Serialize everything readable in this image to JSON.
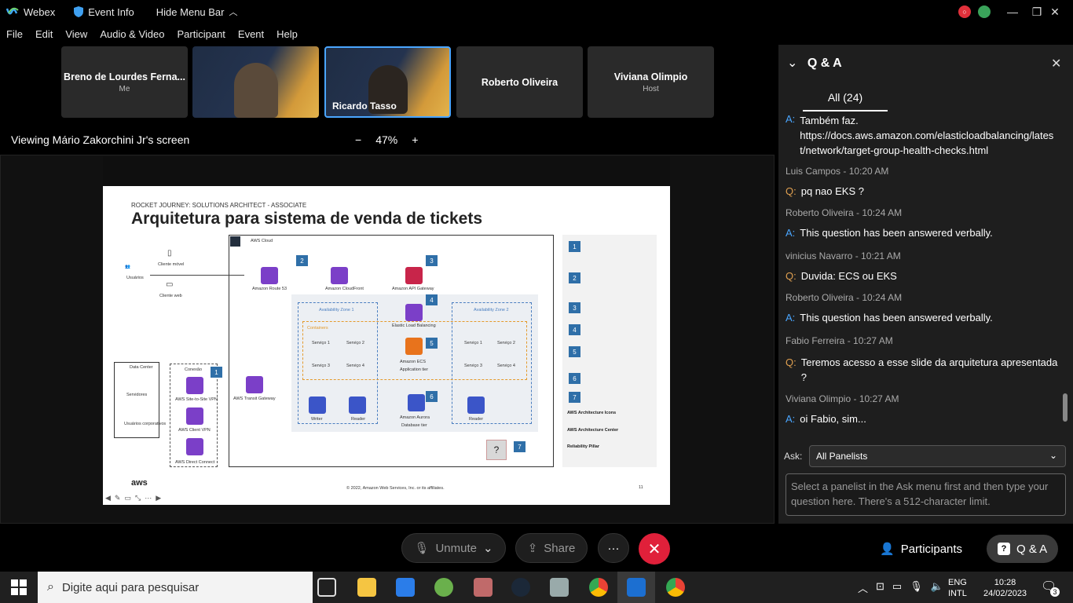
{
  "titlebar": {
    "app": "Webex",
    "event_info": "Event Info",
    "hide_menu": "Hide Menu Bar"
  },
  "menu": [
    "File",
    "Edit",
    "View",
    "Audio & Video",
    "Participant",
    "Event",
    "Help"
  ],
  "tiles": [
    {
      "name": "Breno de Lourdes Ferna...",
      "sub": "Me"
    },
    {
      "name": "",
      "sub": ""
    },
    {
      "name": "Ricardo Tasso",
      "sub": ""
    },
    {
      "name": "Roberto Oliveira",
      "sub": ""
    },
    {
      "name": "Viviana Olimpio",
      "sub": "Host"
    }
  ],
  "viewing": "Viewing Mário Zakorchini Jr's screen",
  "zoom": "47%",
  "slide": {
    "subtitle": "ROCKET JOURNEY: SOLUTIONS ARCHITECT - ASSOCIATE",
    "title": "Arquitetura para sistema de venda de tickets",
    "cloud": "AWS Cloud",
    "usuarios": "Usuários",
    "cliente_movel": "Cliente móvel",
    "cliente_web": "Cliente web",
    "route53": "Amazon Route 53",
    "cloudfront": "Amazon CloudFront",
    "apigw": "Amazon API Gateway",
    "elb": "Elastic Load Balancing",
    "ecs": "Amazon ECS",
    "app_tier": "Application tier",
    "az1": "Availability Zone 1",
    "az2": "Availability Zone 2",
    "containers": "Containers",
    "s1": "Serviço 1",
    "s2": "Serviço 2",
    "s3": "Serviço 3",
    "s4": "Serviço 4",
    "writer": "Writer",
    "reader": "Reader",
    "aurora": "Amazon Aurora",
    "db_tier": "Database tier",
    "datacenter": "Data Center",
    "servidores": "Servidores",
    "usuarios_corp": "Usuários corporativos",
    "conexao": "Conexão",
    "s2s_vpn": "AWS Site-to-Site VPN",
    "client_vpn": "AWS Client VPN",
    "direct_connect": "AWS Direct Connect",
    "transit_gw": "AWS Transit Gateway",
    "copyright": "© 2022, Amazon Web Services, Inc. or its affiliates.",
    "page": "11",
    "aws_logo": "aws",
    "notes_heads": [
      "AWS Architecture Icons",
      "AWS Architecture Center",
      "Reliability Pillar"
    ],
    "numbers": [
      "1",
      "2",
      "3",
      "4",
      "5",
      "6",
      "7"
    ]
  },
  "qa": {
    "title": "Q & A",
    "tab": "All (24)",
    "items": [
      {
        "type": "A",
        "text": "Também faz.\nhttps://docs.aws.amazon.com/elasticloadbalancing/latest/network/target-group-health-checks.html",
        "meta": ""
      },
      {
        "type": "Q",
        "meta": "Luis Campos - 10:20 AM",
        "text": "pq nao EKS ?"
      },
      {
        "type": "A",
        "meta": "Roberto Oliveira - 10:24 AM",
        "text": "This question has been answered verbally."
      },
      {
        "type": "Q",
        "meta": "vinicius Navarro - 10:21 AM",
        "text": "Duvida: ECS ou EKS"
      },
      {
        "type": "A",
        "meta": "Roberto Oliveira - 10:24 AM",
        "text": "This question has been answered verbally."
      },
      {
        "type": "Q",
        "meta": "Fabio Ferreira - 10:27 AM",
        "text": "Teremos acesso a esse slide da arquitetura apresentada ?"
      },
      {
        "type": "A",
        "meta": "Viviana Olimpio - 10:27 AM",
        "text": "oi Fabio, sim..."
      }
    ],
    "ask_label": "Ask:",
    "ask_value": "All Panelists",
    "input_placeholder": "Select a panelist in the Ask menu first and then type your question here. There's a 512-character limit."
  },
  "controls": {
    "unmute": "Unmute",
    "share": "Share",
    "more": "···",
    "participants": "Participants",
    "qa": "Q & A"
  },
  "taskbar": {
    "search_placeholder": "Digite aqui para pesquisar",
    "lang1": "ENG",
    "lang2": "INTL",
    "time": "10:28",
    "date": "24/02/2023",
    "notif": "3"
  },
  "colors": {
    "accent_blue": "#4aa6ff",
    "leave_red": "#e0203a",
    "aws_purple": "#7b3fc8"
  }
}
